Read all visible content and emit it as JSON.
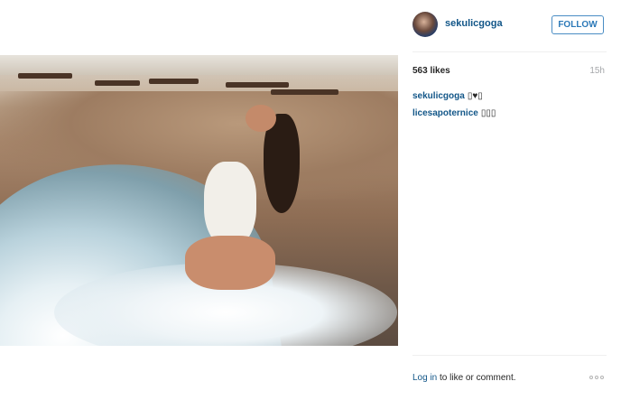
{
  "post": {
    "image_alt": "Woman in white swimsuit kneeling in the surf on a beach",
    "author": {
      "username": "sekulicgoga"
    },
    "follow_label": "FOLLOW",
    "likes": "563 likes",
    "time": "15h",
    "comments": [
      {
        "author": "sekulicgoga",
        "text": "▯♥▯"
      },
      {
        "author": "licesapoternice",
        "text": "▯▯▯"
      }
    ],
    "footer": {
      "login_link": "Log in",
      "login_suffix": " to like or comment."
    }
  },
  "icons": {
    "more": "more-options-icon",
    "avatar": "avatar-image"
  },
  "colors": {
    "link": "#125688",
    "follow_border": "#4a8dc4",
    "muted": "#a5a7aa"
  }
}
